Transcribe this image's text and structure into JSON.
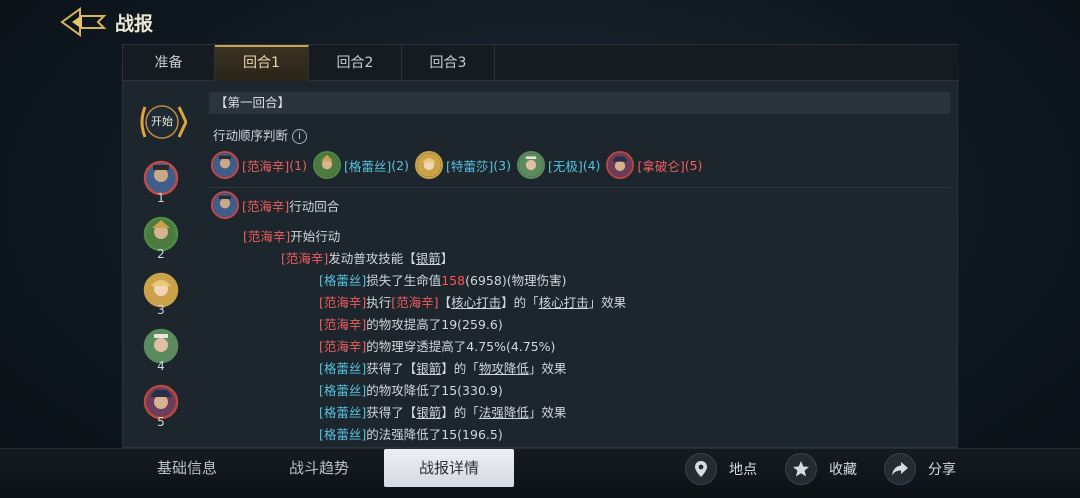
{
  "header": {
    "title": "战报"
  },
  "tabs": [
    {
      "label": "准备",
      "active": false
    },
    {
      "label": "回合1",
      "active": true
    },
    {
      "label": "回合2",
      "active": false
    },
    {
      "label": "回合3",
      "active": false
    }
  ],
  "rail": {
    "start_label": "开始",
    "items": [
      {
        "num": "1",
        "hero": "范海辛",
        "color": "#c24a4a"
      },
      {
        "num": "2",
        "hero": "格蕾丝",
        "color": "#4d8a45"
      },
      {
        "num": "3",
        "hero": "特蕾莎",
        "color": "#c9a24a"
      },
      {
        "num": "4",
        "hero": "无极",
        "color": "#5b8a5e"
      },
      {
        "num": "5",
        "hero": "拿破仑",
        "color": "#b8473f"
      }
    ]
  },
  "log": {
    "round_header": "【第一回合】",
    "order_title": "行动顺序判断",
    "info_icon_glyph": "i",
    "order": [
      {
        "name": "[范海辛]",
        "index": "(1)",
        "side": "red",
        "color": "#3f5f8a"
      },
      {
        "name": "[格蕾丝]",
        "index": "(2)",
        "side": "blue",
        "color": "#4d7a3e"
      },
      {
        "name": "[特蕾莎]",
        "index": "(3)",
        "side": "blue",
        "color": "#c9a24a"
      },
      {
        "name": "[无极]",
        "index": "(4)",
        "side": "blue",
        "color": "#5b8a5e"
      },
      {
        "name": "[拿破仑]",
        "index": "(5)",
        "side": "red",
        "color": "#6b3d5a"
      }
    ],
    "turn_line": {
      "name": "[范海辛]",
      "text": "行动回合"
    },
    "start_action": {
      "name": "[范海辛]",
      "text": "开始行动"
    },
    "skill_line": {
      "name": "[范海辛]",
      "text": "发动普攻技能【",
      "skill": "银箭",
      "end": "】"
    },
    "effects": {
      "e1": {
        "name": "[格蕾丝]",
        "a": "损失了生命值",
        "dmg": "158",
        "b": "(6958)(物理伤害)"
      },
      "e2": {
        "name": "[范海辛]",
        "a": "执行",
        "name2": "[范海辛]",
        "b": "【",
        "skill": "核心打击",
        "c": "】的「",
        "skill2": "核心打击",
        "d": "」效果"
      },
      "e3": {
        "name": "[范海辛]",
        "text": "的物攻提高了19(259.6)"
      },
      "e4": {
        "name": "[范海辛]",
        "text": "的物理穿透提高了4.75%(4.75%)"
      },
      "e5": {
        "name": "[格蕾丝]",
        "a": "获得了【",
        "skill": "银箭",
        "b": "】的「",
        "skill2": "物攻降低",
        "c": "」效果"
      },
      "e6": {
        "name": "[格蕾丝]",
        "text": "的物攻降低了15(330.9)"
      },
      "e7": {
        "name": "[格蕾丝]",
        "a": "获得了【",
        "skill": "银箭",
        "b": "】的「",
        "skill2": "法强降低",
        "c": "」效果"
      },
      "e8": {
        "name": "[格蕾丝]",
        "text": "的法强降低了15(196.5)"
      }
    }
  },
  "bottom_tabs": [
    {
      "label": "基础信息",
      "active": false
    },
    {
      "label": "战斗趋势",
      "active": false
    },
    {
      "label": "战报详情",
      "active": true
    }
  ],
  "actions": [
    {
      "label": "地点",
      "icon": "location-pin-icon"
    },
    {
      "label": "收藏",
      "icon": "star-icon"
    },
    {
      "label": "分享",
      "icon": "share-arrow-icon"
    }
  ],
  "colors": {
    "accent_gold": "#c9a34e",
    "red_team": "#ef5e5e",
    "blue_team": "#54c2dd",
    "damage": "#ff4f4f"
  }
}
